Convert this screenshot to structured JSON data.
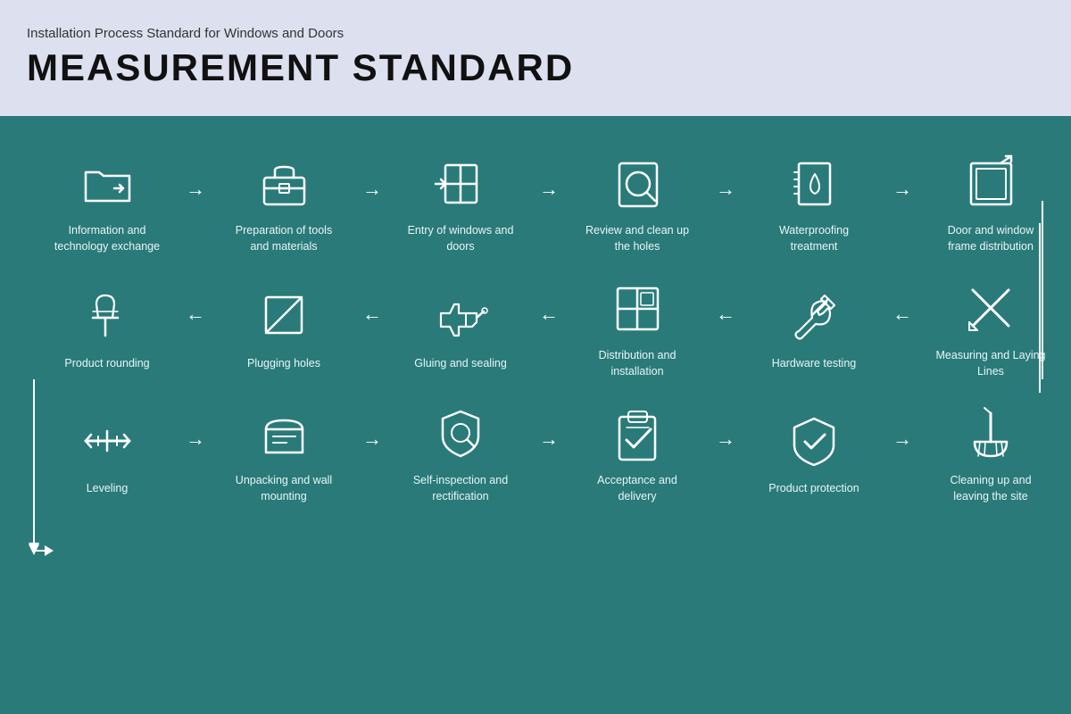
{
  "header": {
    "subtitle": "Installation Process Standard for Windows and Doors",
    "title": "MEASUREMENT STANDARD"
  },
  "rows": [
    {
      "id": "row1",
      "direction": "ltr",
      "steps": [
        {
          "id": "info-exchange",
          "label": "Information and technology exchange",
          "icon": "folder"
        },
        {
          "id": "tools-prep",
          "label": "Preparation of tools and materials",
          "icon": "toolbox"
        },
        {
          "id": "entry-windows",
          "label": "Entry of windows and doors",
          "icon": "window-entry"
        },
        {
          "id": "review-holes",
          "label": "Review and clean up the holes",
          "icon": "magnifier"
        },
        {
          "id": "waterproofing",
          "label": "Waterproofing treatment",
          "icon": "waterproof"
        },
        {
          "id": "frame-dist",
          "label": "Door and window frame distribution",
          "icon": "frame-dist"
        }
      ]
    },
    {
      "id": "row2",
      "direction": "rtl",
      "steps": [
        {
          "id": "measuring",
          "label": "Measuring and Laying Lines",
          "icon": "measure"
        },
        {
          "id": "hardware",
          "label": "Hardware testing",
          "icon": "hardware"
        },
        {
          "id": "distribution",
          "label": "Distribution and installation",
          "icon": "distribution"
        },
        {
          "id": "gluing",
          "label": "Gluing and sealing",
          "icon": "glue"
        },
        {
          "id": "plugging",
          "label": "Plugging holes",
          "icon": "plug"
        },
        {
          "id": "rounding",
          "label": "Product rounding",
          "icon": "pin"
        }
      ]
    },
    {
      "id": "row3",
      "direction": "ltr",
      "steps": [
        {
          "id": "leveling",
          "label": "Leveling",
          "icon": "level"
        },
        {
          "id": "unpacking",
          "label": "Unpacking and wall mounting",
          "icon": "unpack"
        },
        {
          "id": "self-inspect",
          "label": "Self-inspection and rectification",
          "icon": "self-inspect"
        },
        {
          "id": "acceptance",
          "label": "Acceptance and delivery",
          "icon": "accept"
        },
        {
          "id": "protection",
          "label": "Product protection",
          "icon": "shield"
        },
        {
          "id": "cleanup",
          "label": "Cleaning up and leaving the site",
          "icon": "broom"
        }
      ]
    }
  ]
}
